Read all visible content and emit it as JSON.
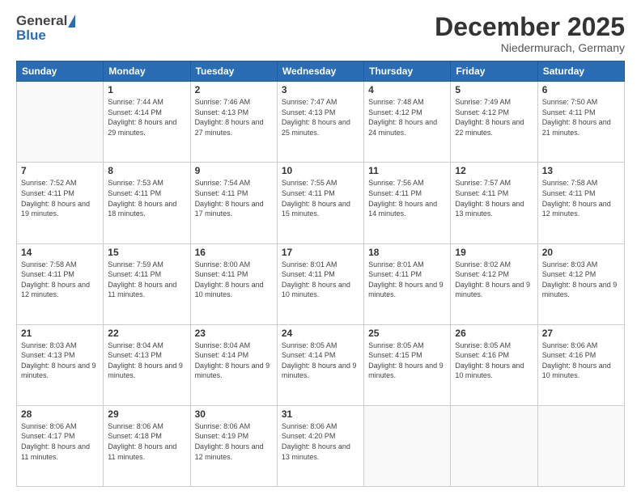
{
  "header": {
    "logo_general": "General",
    "logo_blue": "Blue",
    "month_title": "December 2025",
    "location": "Niedermurach, Germany"
  },
  "days_of_week": [
    "Sunday",
    "Monday",
    "Tuesday",
    "Wednesday",
    "Thursday",
    "Friday",
    "Saturday"
  ],
  "weeks": [
    [
      {
        "day": "",
        "sunrise": "",
        "sunset": "",
        "daylight": ""
      },
      {
        "day": "1",
        "sunrise": "Sunrise: 7:44 AM",
        "sunset": "Sunset: 4:14 PM",
        "daylight": "Daylight: 8 hours and 29 minutes."
      },
      {
        "day": "2",
        "sunrise": "Sunrise: 7:46 AM",
        "sunset": "Sunset: 4:13 PM",
        "daylight": "Daylight: 8 hours and 27 minutes."
      },
      {
        "day": "3",
        "sunrise": "Sunrise: 7:47 AM",
        "sunset": "Sunset: 4:13 PM",
        "daylight": "Daylight: 8 hours and 25 minutes."
      },
      {
        "day": "4",
        "sunrise": "Sunrise: 7:48 AM",
        "sunset": "Sunset: 4:12 PM",
        "daylight": "Daylight: 8 hours and 24 minutes."
      },
      {
        "day": "5",
        "sunrise": "Sunrise: 7:49 AM",
        "sunset": "Sunset: 4:12 PM",
        "daylight": "Daylight: 8 hours and 22 minutes."
      },
      {
        "day": "6",
        "sunrise": "Sunrise: 7:50 AM",
        "sunset": "Sunset: 4:11 PM",
        "daylight": "Daylight: 8 hours and 21 minutes."
      }
    ],
    [
      {
        "day": "7",
        "sunrise": "Sunrise: 7:52 AM",
        "sunset": "Sunset: 4:11 PM",
        "daylight": "Daylight: 8 hours and 19 minutes."
      },
      {
        "day": "8",
        "sunrise": "Sunrise: 7:53 AM",
        "sunset": "Sunset: 4:11 PM",
        "daylight": "Daylight: 8 hours and 18 minutes."
      },
      {
        "day": "9",
        "sunrise": "Sunrise: 7:54 AM",
        "sunset": "Sunset: 4:11 PM",
        "daylight": "Daylight: 8 hours and 17 minutes."
      },
      {
        "day": "10",
        "sunrise": "Sunrise: 7:55 AM",
        "sunset": "Sunset: 4:11 PM",
        "daylight": "Daylight: 8 hours and 15 minutes."
      },
      {
        "day": "11",
        "sunrise": "Sunrise: 7:56 AM",
        "sunset": "Sunset: 4:11 PM",
        "daylight": "Daylight: 8 hours and 14 minutes."
      },
      {
        "day": "12",
        "sunrise": "Sunrise: 7:57 AM",
        "sunset": "Sunset: 4:11 PM",
        "daylight": "Daylight: 8 hours and 13 minutes."
      },
      {
        "day": "13",
        "sunrise": "Sunrise: 7:58 AM",
        "sunset": "Sunset: 4:11 PM",
        "daylight": "Daylight: 8 hours and 12 minutes."
      }
    ],
    [
      {
        "day": "14",
        "sunrise": "Sunrise: 7:58 AM",
        "sunset": "Sunset: 4:11 PM",
        "daylight": "Daylight: 8 hours and 12 minutes."
      },
      {
        "day": "15",
        "sunrise": "Sunrise: 7:59 AM",
        "sunset": "Sunset: 4:11 PM",
        "daylight": "Daylight: 8 hours and 11 minutes."
      },
      {
        "day": "16",
        "sunrise": "Sunrise: 8:00 AM",
        "sunset": "Sunset: 4:11 PM",
        "daylight": "Daylight: 8 hours and 10 minutes."
      },
      {
        "day": "17",
        "sunrise": "Sunrise: 8:01 AM",
        "sunset": "Sunset: 4:11 PM",
        "daylight": "Daylight: 8 hours and 10 minutes."
      },
      {
        "day": "18",
        "sunrise": "Sunrise: 8:01 AM",
        "sunset": "Sunset: 4:11 PM",
        "daylight": "Daylight: 8 hours and 9 minutes."
      },
      {
        "day": "19",
        "sunrise": "Sunrise: 8:02 AM",
        "sunset": "Sunset: 4:12 PM",
        "daylight": "Daylight: 8 hours and 9 minutes."
      },
      {
        "day": "20",
        "sunrise": "Sunrise: 8:03 AM",
        "sunset": "Sunset: 4:12 PM",
        "daylight": "Daylight: 8 hours and 9 minutes."
      }
    ],
    [
      {
        "day": "21",
        "sunrise": "Sunrise: 8:03 AM",
        "sunset": "Sunset: 4:13 PM",
        "daylight": "Daylight: 8 hours and 9 minutes."
      },
      {
        "day": "22",
        "sunrise": "Sunrise: 8:04 AM",
        "sunset": "Sunset: 4:13 PM",
        "daylight": "Daylight: 8 hours and 9 minutes."
      },
      {
        "day": "23",
        "sunrise": "Sunrise: 8:04 AM",
        "sunset": "Sunset: 4:14 PM",
        "daylight": "Daylight: 8 hours and 9 minutes."
      },
      {
        "day": "24",
        "sunrise": "Sunrise: 8:05 AM",
        "sunset": "Sunset: 4:14 PM",
        "daylight": "Daylight: 8 hours and 9 minutes."
      },
      {
        "day": "25",
        "sunrise": "Sunrise: 8:05 AM",
        "sunset": "Sunset: 4:15 PM",
        "daylight": "Daylight: 8 hours and 9 minutes."
      },
      {
        "day": "26",
        "sunrise": "Sunrise: 8:05 AM",
        "sunset": "Sunset: 4:16 PM",
        "daylight": "Daylight: 8 hours and 10 minutes."
      },
      {
        "day": "27",
        "sunrise": "Sunrise: 8:06 AM",
        "sunset": "Sunset: 4:16 PM",
        "daylight": "Daylight: 8 hours and 10 minutes."
      }
    ],
    [
      {
        "day": "28",
        "sunrise": "Sunrise: 8:06 AM",
        "sunset": "Sunset: 4:17 PM",
        "daylight": "Daylight: 8 hours and 11 minutes."
      },
      {
        "day": "29",
        "sunrise": "Sunrise: 8:06 AM",
        "sunset": "Sunset: 4:18 PM",
        "daylight": "Daylight: 8 hours and 11 minutes."
      },
      {
        "day": "30",
        "sunrise": "Sunrise: 8:06 AM",
        "sunset": "Sunset: 4:19 PM",
        "daylight": "Daylight: 8 hours and 12 minutes."
      },
      {
        "day": "31",
        "sunrise": "Sunrise: 8:06 AM",
        "sunset": "Sunset: 4:20 PM",
        "daylight": "Daylight: 8 hours and 13 minutes."
      },
      {
        "day": "",
        "sunrise": "",
        "sunset": "",
        "daylight": ""
      },
      {
        "day": "",
        "sunrise": "",
        "sunset": "",
        "daylight": ""
      },
      {
        "day": "",
        "sunrise": "",
        "sunset": "",
        "daylight": ""
      }
    ]
  ]
}
